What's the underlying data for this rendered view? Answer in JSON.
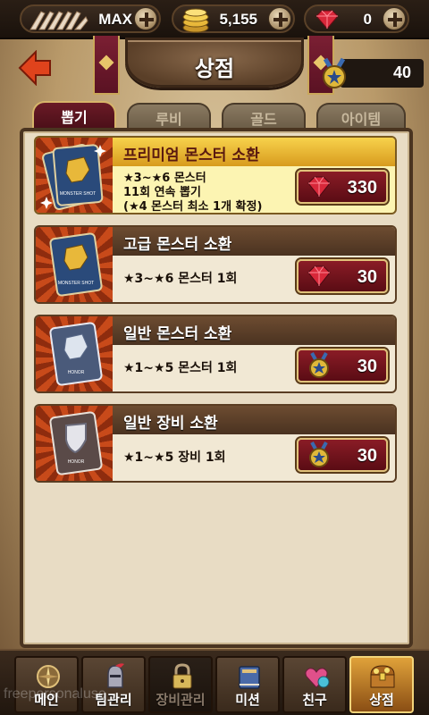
{
  "resources": {
    "stamina": "MAX",
    "gold": "5,155",
    "gems": "0"
  },
  "header": {
    "title": "상점",
    "honor_count": "40"
  },
  "tabs": [
    {
      "label": "뽑기",
      "active": true
    },
    {
      "label": "루비",
      "active": false
    },
    {
      "label": "골드",
      "active": false
    },
    {
      "label": "아이템",
      "active": false
    }
  ],
  "items": [
    {
      "name": "프리미엄 몬스터 소환",
      "desc_lines": [
        "★3~★6 몬스터",
        "11회 연속 뽑기",
        "(★4 몬스터 최소 1개 확정)"
      ],
      "price": "330",
      "currency": "ruby-icon",
      "card_text": "MONSTER SHOT",
      "premium": true
    },
    {
      "name": "고급 몬스터 소환",
      "desc_lines": [
        "★3~★6 몬스터 1회"
      ],
      "price": "30",
      "currency": "ruby-icon",
      "card_text": "MONSTER SHOT",
      "premium": false
    },
    {
      "name": "일반 몬스터 소환",
      "desc_lines": [
        "★1~★5 몬스터 1회"
      ],
      "price": "30",
      "currency": "honor-medal-icon",
      "card_text": "HONOR",
      "premium": false
    },
    {
      "name": "일반 장비 소환",
      "desc_lines": [
        "★1~★5 장비 1회"
      ],
      "price": "30",
      "currency": "honor-medal-icon",
      "card_text": "HONOR",
      "premium": false
    }
  ],
  "nav": [
    {
      "label": "메인",
      "icon": "compass-icon"
    },
    {
      "label": "팀관리",
      "icon": "knight-helmet-icon"
    },
    {
      "label": "장비관리",
      "icon": "lock-icon",
      "locked": true
    },
    {
      "label": "미션",
      "icon": "book-icon"
    },
    {
      "label": "친구",
      "icon": "friends-icon"
    },
    {
      "label": "상점",
      "icon": "treasure-chest-icon",
      "active": true
    }
  ],
  "watermark": "freepersonaluse",
  "colors": {
    "accent_red": "#8a1c26",
    "gold": "#e1c27a",
    "premium_bar": "#f7d24c",
    "panel_bg": "#e8dcc4"
  }
}
